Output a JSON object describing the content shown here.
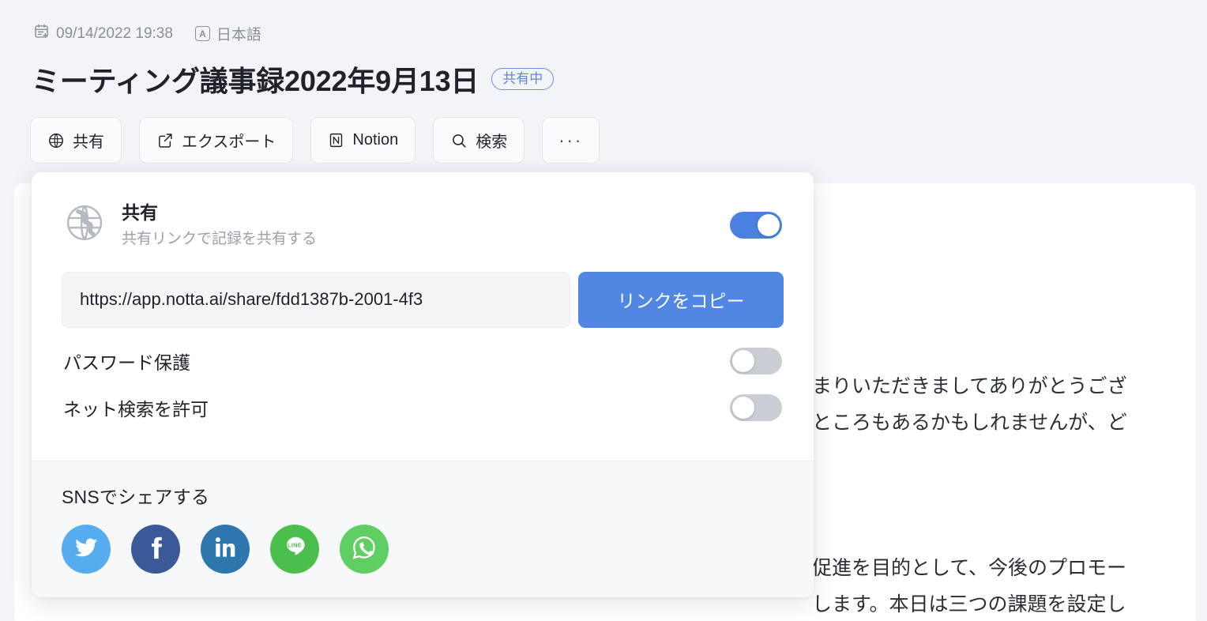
{
  "meta": {
    "date_icon": "calendar-plus-icon",
    "date": "09/14/2022 19:38",
    "language_icon": "language-a-icon",
    "language": "日本語"
  },
  "header": {
    "title": "ミーティング議事録2022年9月13日",
    "status_badge": "共有中",
    "badge_color": "#5f86d6"
  },
  "toolbar": {
    "buttons": [
      {
        "label": "共有",
        "icon": "globe-icon"
      },
      {
        "label": "エクスポート",
        "icon": "export-icon"
      },
      {
        "label": "Notion",
        "icon": "notion-icon"
      },
      {
        "label": "検索",
        "icon": "search-icon"
      },
      {
        "label": "···",
        "icon": "more-icon"
      }
    ]
  },
  "share_panel": {
    "icon": "globe-icon",
    "title": "共有",
    "subtitle": "共有リンクで記録を共有する",
    "share_toggle_state": "on",
    "link_value": "https://app.notta.ai/share/fdd1387b-2001-4f3",
    "copy_button": "リンクをコピー",
    "options": [
      {
        "label": "パスワード保護",
        "state": "off"
      },
      {
        "label": "ネット検索を許可",
        "state": "off"
      }
    ],
    "sns": {
      "title": "SNSでシェアする",
      "items": [
        {
          "name": "twitter",
          "color": "#55acee"
        },
        {
          "name": "facebook",
          "color": "#3b5998"
        },
        {
          "name": "linkedin",
          "color": "#2e77ae"
        },
        {
          "name": "line",
          "color": "#4bbf4b"
        },
        {
          "name": "whatsapp",
          "color": "#5fce63"
        }
      ]
    },
    "accent_color": "#5187e3"
  },
  "document": {
    "visible_lines": [
      "まりいただきましてありがとうござ",
      "ところもあるかもしれませんが、ど",
      "促進を目的として、今後のプロモー",
      "します。本日は三つの課題を設定し"
    ]
  }
}
